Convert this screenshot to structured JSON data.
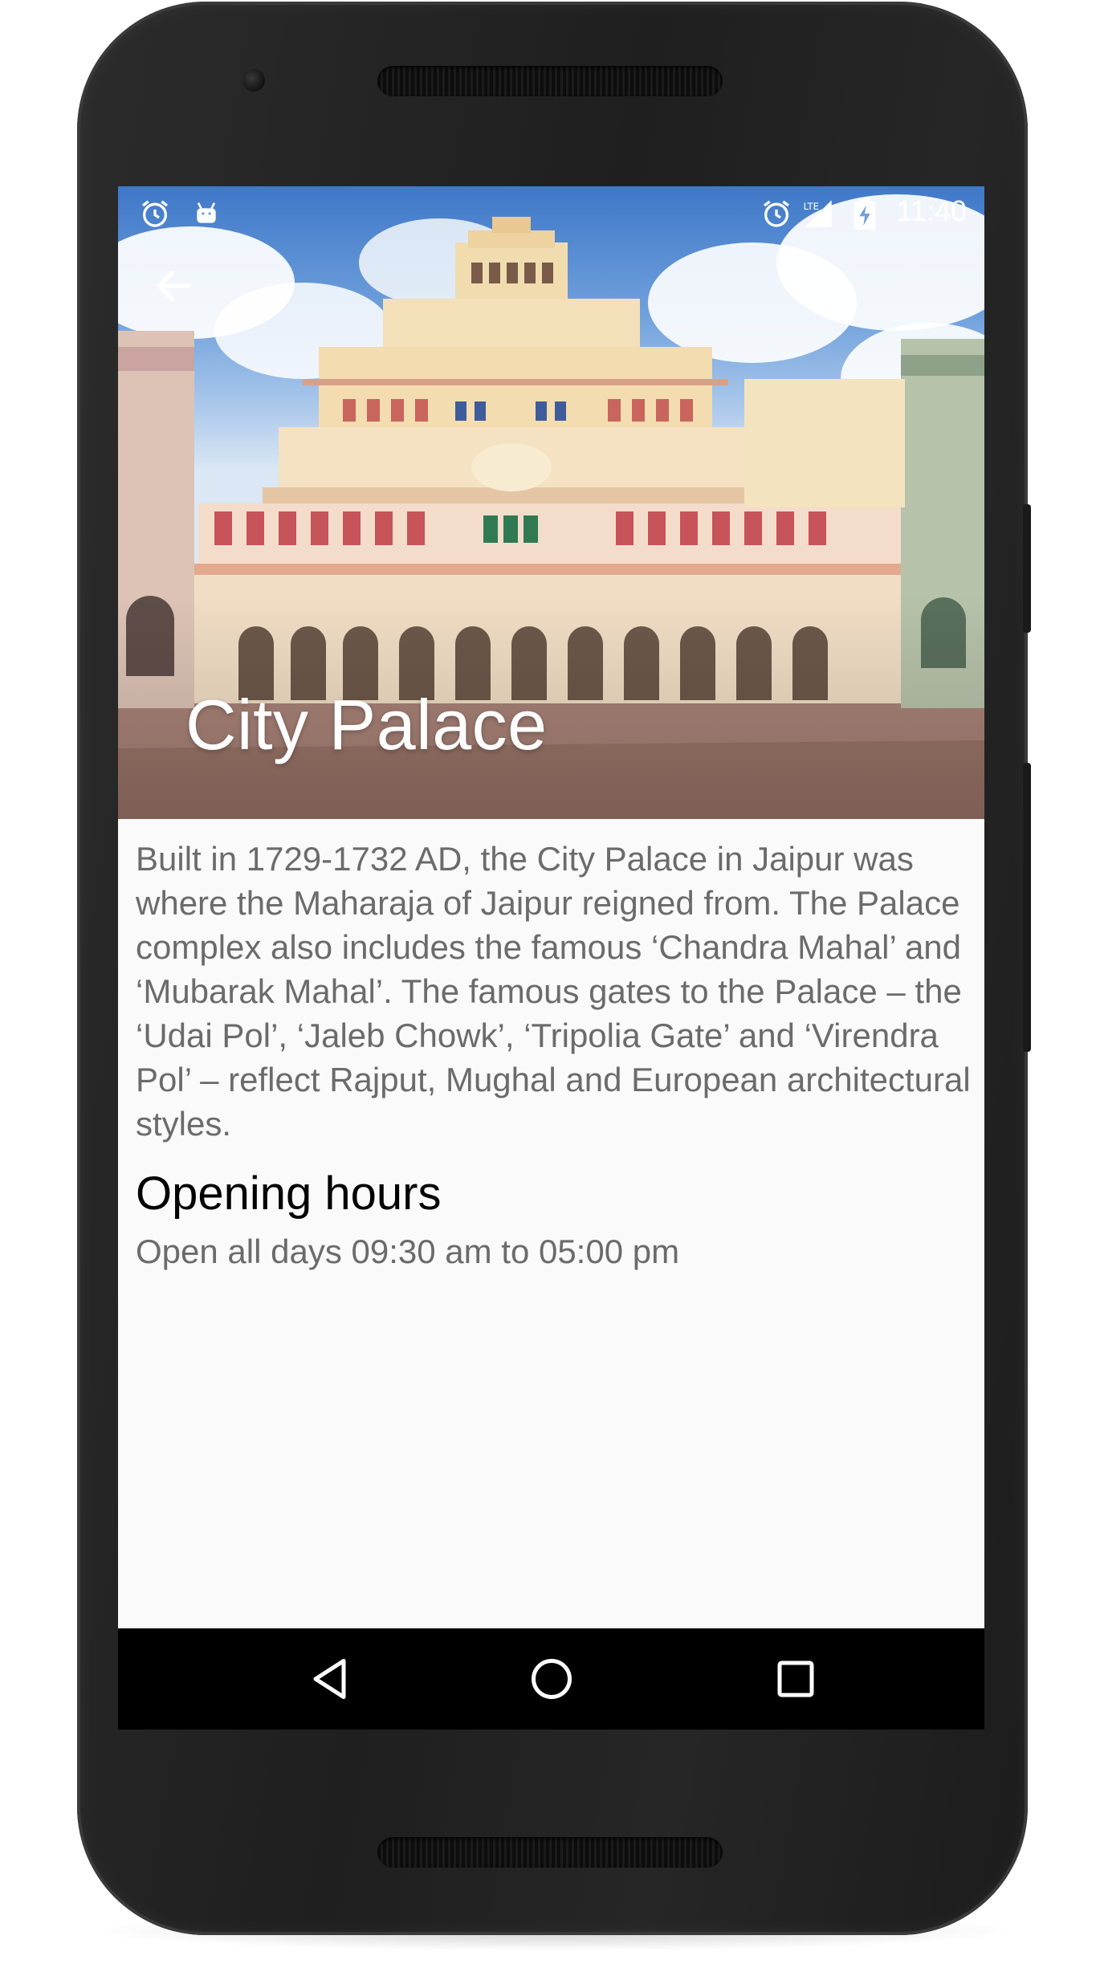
{
  "status_bar": {
    "time": "11:40",
    "left_icons": [
      "alarm-icon",
      "android-icon"
    ],
    "right_icons": [
      "alarm-icon",
      "lte-signal-icon",
      "battery-charging-icon"
    ]
  },
  "toolbar": {
    "back_icon": "back-arrow-icon"
  },
  "place": {
    "title": "City Palace",
    "description": "Built in 1729-1732 AD, the City Palace in Jaipur was where the Maharaja of Jaipur reigned from. The Palace complex also includes the famous ‘Chandra Mahal’ and ‘Mubarak Mahal’. The famous gates to the Palace – the ‘Udai Pol’, ‘Jaleb Chowk’, ‘Tripolia Gate’ and ‘Virendra Pol’ – reflect Rajput, Mughal and European architectural styles.",
    "hours_heading": "Opening hours",
    "hours_text": "Open all days 09:30 am to 05:00 pm"
  },
  "nav_bar": {
    "buttons": [
      "back-triangle-icon",
      "home-circle-icon",
      "recents-square-icon"
    ]
  },
  "colors": {
    "screen_background": "#fafafa",
    "body_text": "#6b6b6b",
    "heading_text": "#000000",
    "nav_bar": "#000000",
    "phone_body": "#222222"
  }
}
